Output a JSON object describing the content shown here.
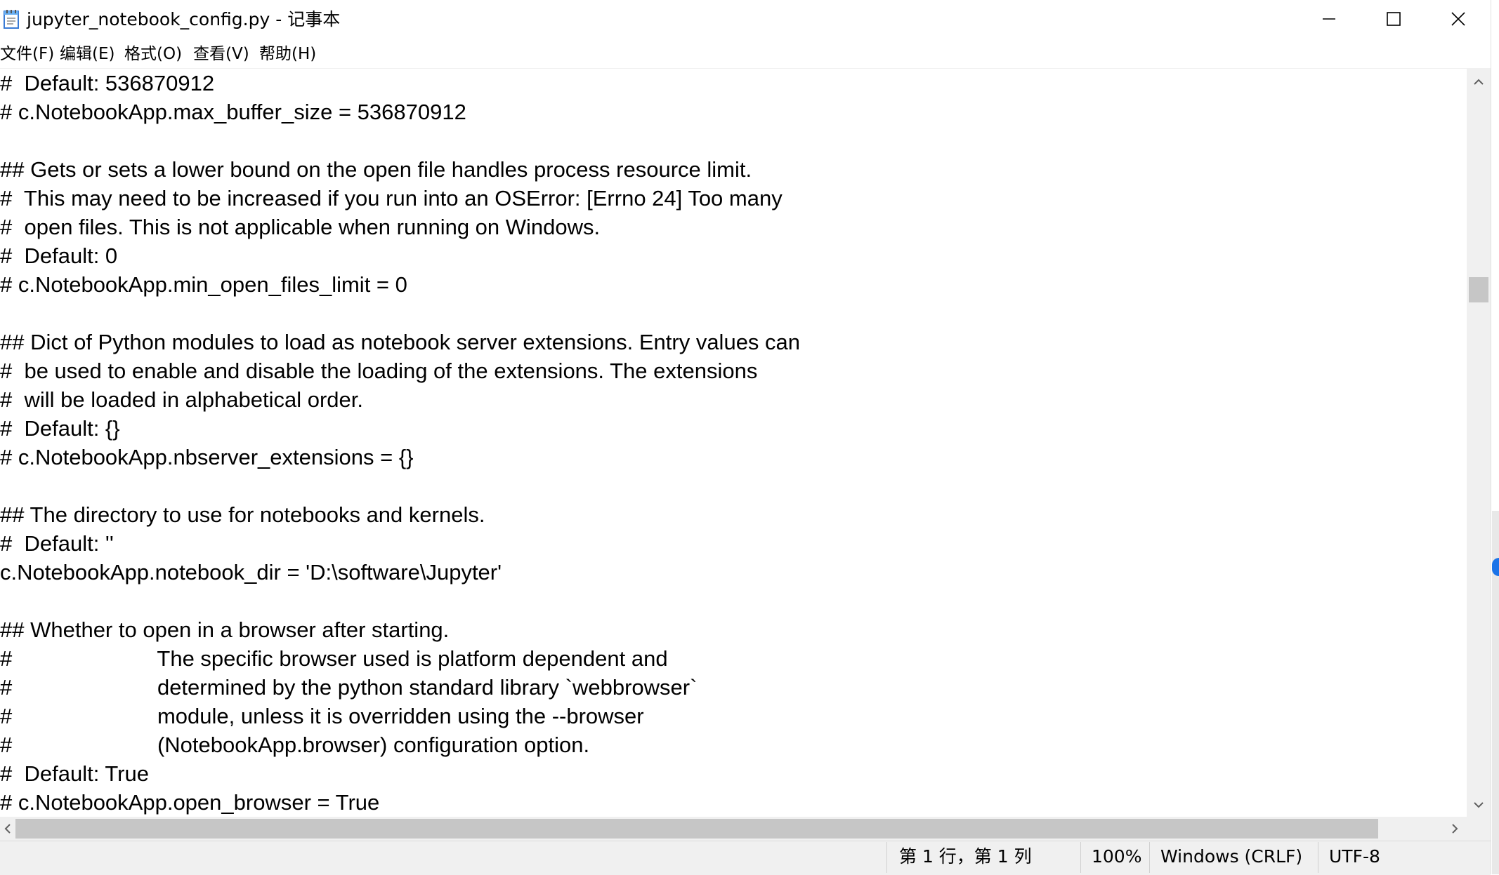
{
  "window": {
    "title": "jupyter_notebook_config.py - 记事本",
    "icon": "notepad-icon"
  },
  "controls": {
    "minimize_icon": "minimize-icon",
    "maximize_icon": "maximize-icon",
    "close_icon": "close-icon"
  },
  "menu": {
    "items": [
      {
        "label": "文件(F)"
      },
      {
        "label": "编辑(E)"
      },
      {
        "label": "格式(O)"
      },
      {
        "label": "查看(V)"
      },
      {
        "label": "帮助(H)"
      }
    ]
  },
  "editor": {
    "lines": [
      "#  Default: 536870912",
      "# c.NotebookApp.max_buffer_size = 536870912",
      "",
      "## Gets or sets a lower bound on the open file handles process resource limit.",
      "#  This may need to be increased if you run into an OSError: [Errno 24] Too many",
      "#  open files. This is not applicable when running on Windows.",
      "#  Default: 0",
      "# c.NotebookApp.min_open_files_limit = 0",
      "",
      "## Dict of Python modules to load as notebook server extensions. Entry values can",
      "#  be used to enable and disable the loading of the extensions. The extensions",
      "#  will be loaded in alphabetical order.",
      "#  Default: {}",
      "# c.NotebookApp.nbserver_extensions = {}",
      "",
      "## The directory to use for notebooks and kernels.",
      "#  Default: ''",
      "c.NotebookApp.notebook_dir = 'D:\\software\\Jupyter'",
      "",
      "## Whether to open in a browser after starting.",
      "#                        The specific browser used is platform dependent and",
      "#                        determined by the python standard library `webbrowser`",
      "#                        module, unless it is overridden using the --browser",
      "#                        (NotebookApp.browser) configuration option.",
      "#  Default: True",
      "# c.NotebookApp.open_browser = True"
    ]
  },
  "status": {
    "position": "第 1 行，第 1 列",
    "zoom": "100%",
    "line_ending": "Windows (CRLF)",
    "encoding": "UTF-8"
  },
  "colors": {
    "chrome": "#f0f0f0",
    "scroll_thumb": "#c6c6c6",
    "text": "#000000",
    "accent": "#1a73e8"
  }
}
